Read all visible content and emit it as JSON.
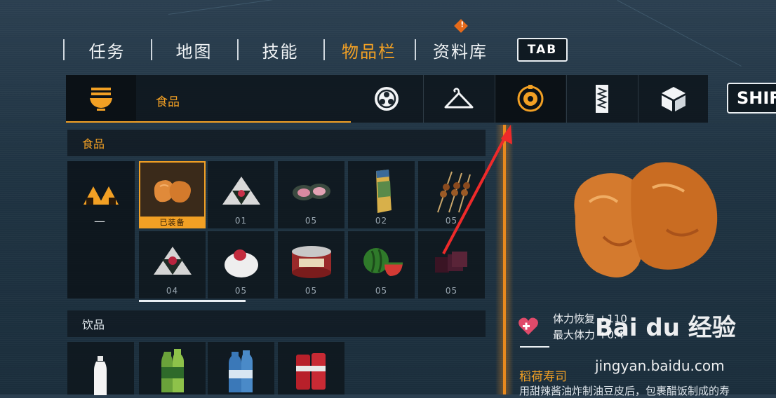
{
  "top_tabs": [
    {
      "label": "任务",
      "active": false
    },
    {
      "label": "地图",
      "active": false
    },
    {
      "label": "技能",
      "active": false
    },
    {
      "label": "物品栏",
      "active": true
    },
    {
      "label": "资料库",
      "active": false
    }
  ],
  "tab_key": "TAB",
  "category_bar": {
    "current_label": "食品",
    "icons": [
      "food-bowl-icon",
      "soccer-ball-icon",
      "hanger-icon",
      "speaker-icon",
      "scroll-icon",
      "cube-icon"
    ],
    "selected_icon": "speaker-icon",
    "shift_key": "SHIF"
  },
  "food_section": {
    "title": "食品",
    "equipped_dash": "—",
    "items": [
      {
        "name": "fried-tofu-sushi",
        "count": "已装备",
        "equipped": true
      },
      {
        "name": "rice-ball",
        "count": "01"
      },
      {
        "name": "meat-wrap",
        "count": "05"
      },
      {
        "name": "wrapped-snack",
        "count": "02"
      },
      {
        "name": "grilled-skewers",
        "count": "05"
      },
      {
        "name": "rice-ball-pickled",
        "count": "04"
      },
      {
        "name": "daifuku",
        "count": "05"
      },
      {
        "name": "canned-fish",
        "count": "05"
      },
      {
        "name": "watermelon",
        "count": "05"
      },
      {
        "name": "yokan-jelly",
        "count": "05"
      }
    ]
  },
  "drink_section": {
    "title": "饮品",
    "items": [
      "water-bottle",
      "green-tea",
      "mineral-water",
      "canned-drink"
    ]
  },
  "detail": {
    "stat1": "体力恢复 +110",
    "stat2": "最大体力 +0.4",
    "name": "稻荷寿司",
    "description": "用甜辣酱油炸制油豆皮后，包裹醋饭制成的寿"
  },
  "watermark": {
    "main": "Bai du 经验",
    "sub": "jingyan.baidu.com"
  },
  "colors": {
    "accent": "#f2a024",
    "bg": "#1f3342",
    "panel": "#0e161c"
  }
}
